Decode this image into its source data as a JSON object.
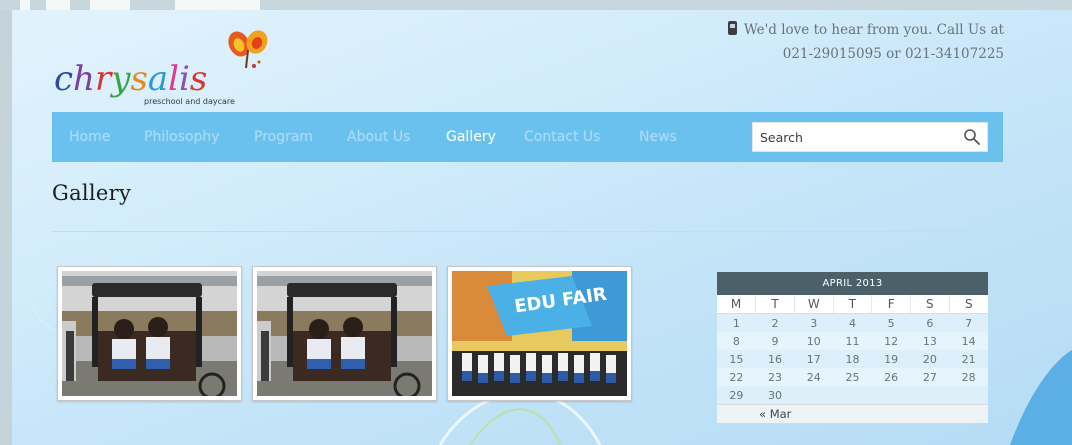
{
  "brand": {
    "logo_text": "chrysalis",
    "logo_tagline": "preschool and daycare"
  },
  "contact": {
    "line1": "We'd love to hear from you. Call Us at",
    "line2": "021-29015095 or 021-34107225"
  },
  "nav": {
    "items": [
      {
        "label": "Home"
      },
      {
        "label": "Philosophy"
      },
      {
        "label": "Program"
      },
      {
        "label": "About Us"
      },
      {
        "label": "Gallery"
      },
      {
        "label": "Contact Us"
      },
      {
        "label": "News"
      }
    ],
    "active": "Gallery"
  },
  "search": {
    "placeholder": "Search"
  },
  "page": {
    "title": "Gallery"
  },
  "gallery": {
    "images": [
      {
        "subject": "children-in-rickshaw"
      },
      {
        "subject": "children-in-rickshaw"
      },
      {
        "subject": "edu-fair-group",
        "sign_text": "EDU FAIR"
      }
    ]
  },
  "calendar": {
    "caption": "APRIL 2013",
    "days": [
      "M",
      "T",
      "W",
      "T",
      "F",
      "S",
      "S"
    ],
    "weeks": [
      [
        "1",
        "2",
        "3",
        "4",
        "5",
        "6",
        "7"
      ],
      [
        "8",
        "9",
        "10",
        "11",
        "12",
        "13",
        "14"
      ],
      [
        "15",
        "16",
        "17",
        "18",
        "19",
        "20",
        "21"
      ],
      [
        "22",
        "23",
        "24",
        "25",
        "26",
        "27",
        "28"
      ],
      [
        "29",
        "30",
        "",
        "",
        "",
        "",
        ""
      ]
    ],
    "prev_link": "« Mar"
  },
  "colors": {
    "nav_bg": "#6bc1ee",
    "nav_text": "#a9dbf6",
    "nav_active": "#ffffff",
    "calendar_header": "#4c6069"
  },
  "icons": {
    "contact": "mobile-phone-icon",
    "search": "search-icon",
    "logo": "butterfly-icon"
  }
}
